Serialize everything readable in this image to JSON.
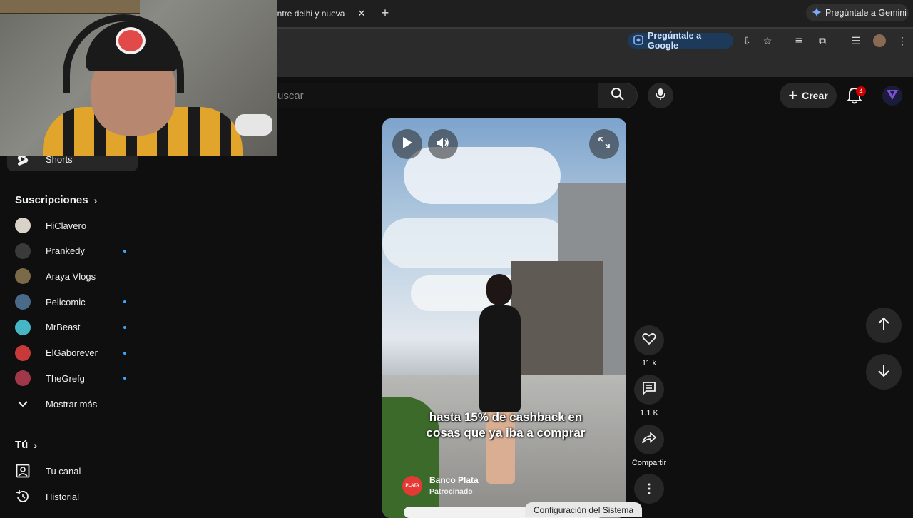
{
  "browser": {
    "tab_title": "a entre delhi y nueva",
    "tab_close": "✕",
    "new_tab": "+",
    "gemini_label": "Pregúntale a Gemini",
    "google_button": "Pregúntale a Google"
  },
  "header": {
    "search_placeholder": "uscar",
    "create_label": "Crear",
    "notification_count": "4"
  },
  "sidebar": {
    "shorts_label": "Shorts",
    "subscriptions_title": "Suscripciones",
    "subscriptions": [
      {
        "name": "HiClavero",
        "new": false,
        "color": "#d9d2c8"
      },
      {
        "name": "Prankedy",
        "new": true,
        "color": "#3a3a3a"
      },
      {
        "name": "Araya Vlogs",
        "new": false,
        "color": "#7a6a48"
      },
      {
        "name": "Pelicomic",
        "new": true,
        "color": "#4a6a8a"
      },
      {
        "name": "MrBeast",
        "new": true,
        "color": "#46b6c6"
      },
      {
        "name": "ElGaborever",
        "new": true,
        "color": "#c83a3a"
      },
      {
        "name": "TheGrefg",
        "new": true,
        "color": "#a0384a"
      }
    ],
    "show_more": "Mostrar más",
    "you_title": "Tú",
    "you_items": [
      {
        "name": "Tu canal",
        "icon": "user-box-icon"
      },
      {
        "name": "Historial",
        "icon": "history-icon"
      }
    ]
  },
  "video": {
    "caption_line1": "hasta 15% de cashback en",
    "caption_line2": "cosas que ya iba a comprar",
    "channel_logo": "PLATA",
    "channel_name": "Banco Plata",
    "sponsored": "Patrocinado"
  },
  "actions": {
    "likes": "11 k",
    "comments": "1.1 K",
    "share": "Compartir"
  },
  "tooltip": "Configuración del Sistema"
}
